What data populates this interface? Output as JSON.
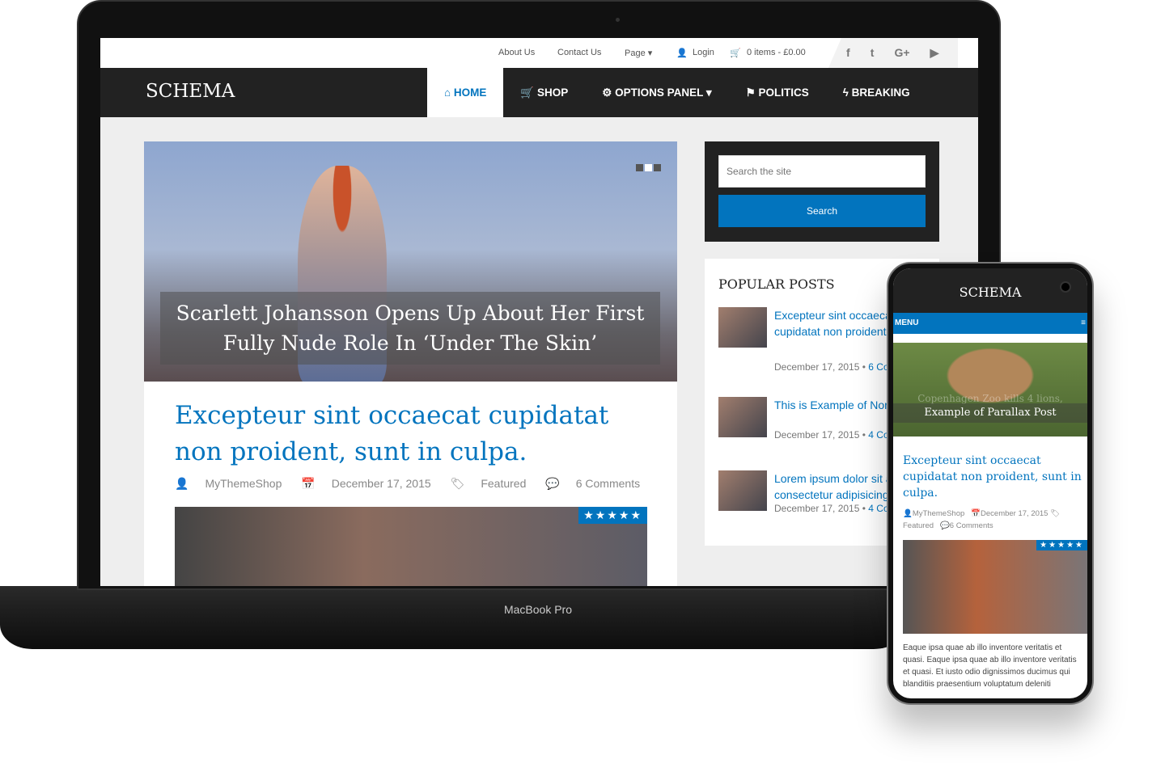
{
  "device": {
    "laptop_label": "MacBook Pro"
  },
  "topbar": {
    "links": [
      "About Us",
      "Contact Us",
      "Page ▾"
    ],
    "login": "Login",
    "cart": "0 items - £0.00",
    "social": [
      "f",
      "t",
      "G+",
      "▶"
    ]
  },
  "site": {
    "logo": "SCHEMA"
  },
  "nav": [
    {
      "label": "HOME",
      "icon": "home-icon",
      "active": true
    },
    {
      "label": "SHOP",
      "icon": "cart-icon"
    },
    {
      "label": "OPTIONS PANEL ▾",
      "icon": "cogs-icon"
    },
    {
      "label": "POLITICS",
      "icon": "flag-icon"
    },
    {
      "label": "BREAKING",
      "icon": "bolt-icon"
    }
  ],
  "slider": {
    "caption": "Scarlett Johansson Opens Up About Her First Fully Nude Role In ‘Under The Skin’",
    "slide_count": 3,
    "active_slide": 2
  },
  "post": {
    "title": "Excepteur sint occaecat cupidatat non proident, sunt in culpa.",
    "author": "MyThemeShop",
    "date": "December 17, 2015",
    "category": "Featured",
    "comments": "6 Comments",
    "rating": 5,
    "stars": "★★★★★"
  },
  "search": {
    "placeholder": "Search the site",
    "button": "Search"
  },
  "popular": {
    "title": "POPULAR POSTS",
    "items": [
      {
        "title": "Excepteur sint occaecat cupidatat non proident, sunt ...",
        "date": "December 17, 2015",
        "comments": "6 Comments"
      },
      {
        "title": "This is Example of Non Sidebar",
        "date": "December 17, 2015",
        "comments": "4 Comments"
      },
      {
        "title": "Lorem ipsum dolor sit amet, consectetur adipisicing",
        "date": "December 17, 2015",
        "comments": "4 Comments"
      }
    ]
  },
  "mobile": {
    "logo": "SCHEMA",
    "menu": "MENU",
    "slide_caption": "Example of Parallax Post",
    "slide_caption_behind": "Copenhagen Zoo kills 4 lions,",
    "post_title": "Excepteur sint occaecat cupidatat non proident, sunt in culpa.",
    "author": "MyThemeShop",
    "date": "December 17, 2015",
    "category": "Featured",
    "comments": "6 Comments",
    "stars": "★★★★★",
    "excerpt": "Eaque ipsa quae ab illo inventore veritatis et quasi. Eaque ipsa quae ab illo inventore veritatis et quasi. Et iusto odio dignissimos ducimus qui blanditiis praesentium voluptatum deleniti"
  },
  "colors": {
    "accent": "#0274be",
    "nav_bg": "#222222"
  }
}
